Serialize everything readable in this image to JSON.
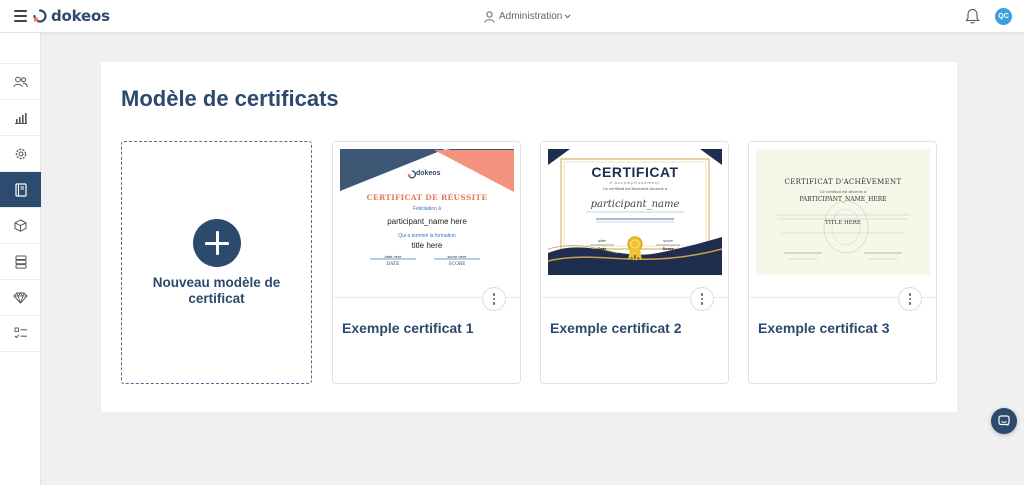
{
  "header": {
    "brand": "dokeos",
    "admin_label": "Administration",
    "avatar_initials": "QC"
  },
  "sidebar": {
    "items": [
      {
        "icon": "users-icon"
      },
      {
        "icon": "chart-icon"
      },
      {
        "icon": "gear-icon"
      },
      {
        "icon": "certificate-book-icon",
        "active": true
      },
      {
        "icon": "cube-icon"
      },
      {
        "icon": "stack-icon"
      },
      {
        "icon": "gem-icon"
      },
      {
        "icon": "checklist-icon"
      }
    ]
  },
  "main": {
    "title": "Modèle de certificats",
    "new_card_label": "Nouveau modèle de certificat",
    "cards": [
      {
        "title": "Exemple certificat 1",
        "thumb": {
          "brand": "dokeos",
          "heading": "CERTIFICAT DE RÉUSSITE",
          "congrats": "Félicitation à",
          "name": "participant_name here",
          "completed": "Qui a terminé la formation",
          "course": "title here",
          "date_value": "date here",
          "score_value": "score here",
          "date_label": "DATE",
          "score_label": "SCORE"
        }
      },
      {
        "title": "Exemple certificat 2",
        "thumb": {
          "heading": "CERTIFICAT",
          "sub": "d'accomplissement",
          "line": "Ce certificat est fièrement décerné à",
          "name": "participant_name",
          "date_value": "date",
          "score_value": "score",
          "date_label": "Date",
          "score_label": "Score"
        }
      },
      {
        "title": "Exemple certificat 3",
        "thumb": {
          "heading": "CERTIFICAT D'ACHÈVEMENT",
          "line": "Ce certificat est décerné à",
          "name": "PARTICIPANT_NAME_HERE",
          "course": "TITLE HERE"
        }
      }
    ]
  },
  "colors": {
    "primary": "#2c4a6e",
    "accent_salmon": "#f28c75",
    "avatar": "#3aa0de"
  }
}
